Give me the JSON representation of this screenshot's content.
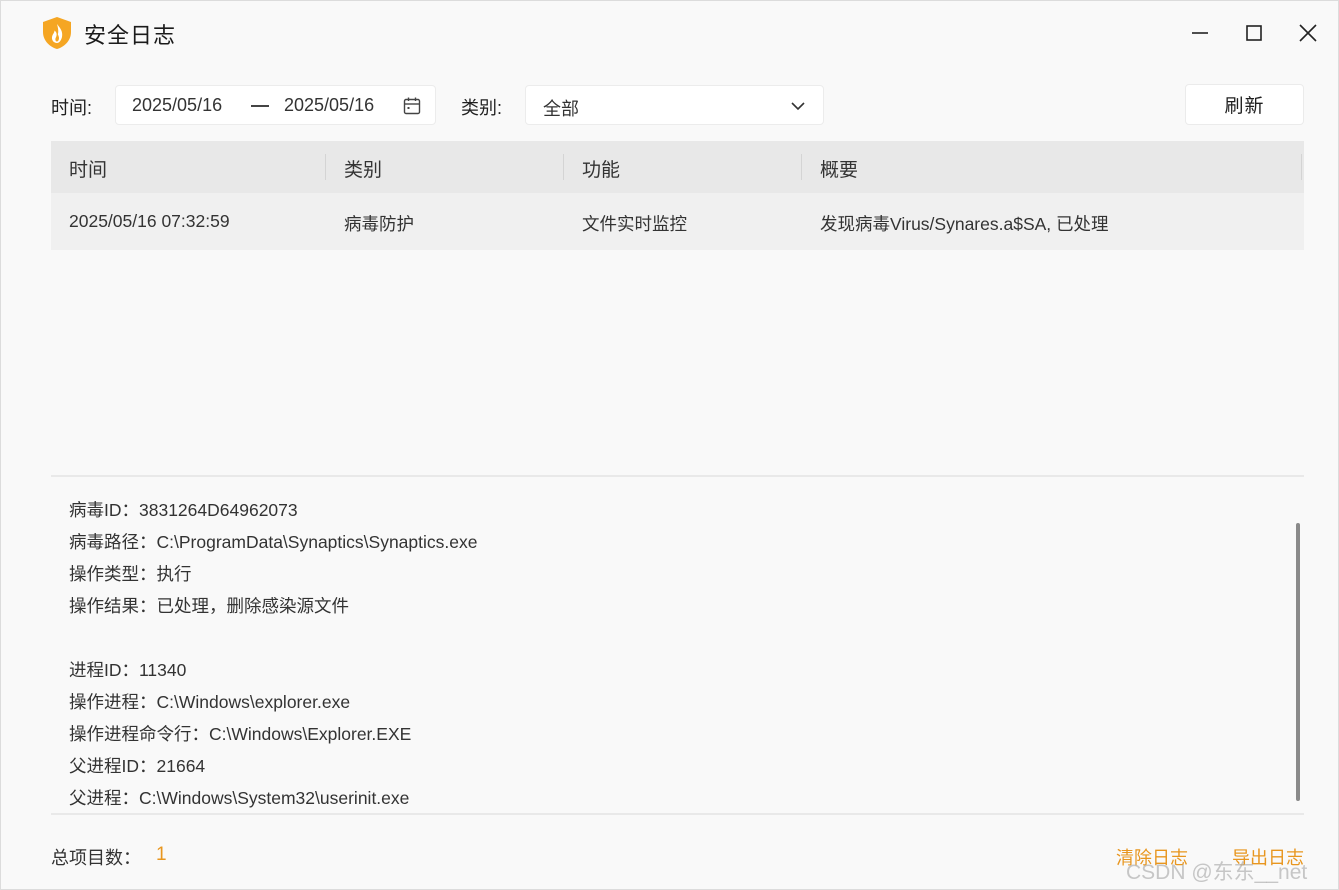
{
  "window": {
    "title": "安全日志",
    "accent_color": "#f5a623"
  },
  "filters": {
    "time_label": "时间:",
    "date_start": "2025/05/16",
    "date_end": "2025/05/16",
    "category_label": "类别:",
    "category_value": "全部",
    "refresh_label": "刷新"
  },
  "table": {
    "headers": [
      "时间",
      "类别",
      "功能",
      "概要"
    ],
    "rows": [
      {
        "time": "2025/05/16 07:32:59",
        "category": "病毒防护",
        "function": "文件实时监控",
        "summary": "发现病毒Virus/Synares.a$SA, 已处理"
      }
    ]
  },
  "details": {
    "lines": [
      "病毒ID：3831264D64962073",
      "病毒路径：C:\\ProgramData\\Synaptics\\Synaptics.exe",
      "操作类型：执行",
      "操作结果：已处理，删除感染源文件",
      "",
      "进程ID：11340",
      "操作进程：C:\\Windows\\explorer.exe",
      "操作进程命令行：C:\\Windows\\Explorer.EXE",
      "父进程ID：21664",
      "父进程：C:\\Windows\\System32\\userinit.exe"
    ]
  },
  "footer": {
    "total_label": "总项目数：",
    "total_count": "1",
    "clear_label": "清除日志",
    "export_label": "导出日志",
    "link_color": "#e8961f"
  },
  "watermark": "CSDN @东东__net"
}
